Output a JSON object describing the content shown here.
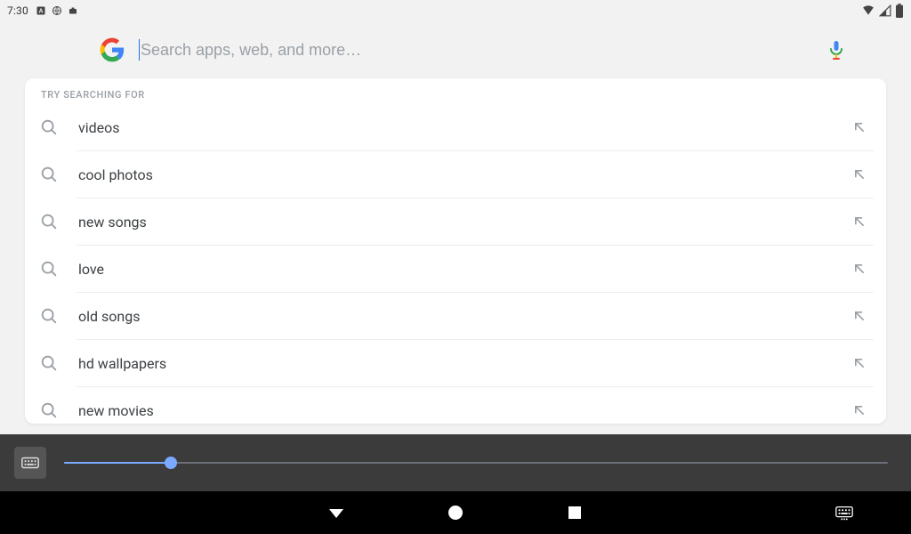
{
  "status_bar": {
    "time": "7:30"
  },
  "search": {
    "placeholder": "Search apps, web, and more…",
    "value": ""
  },
  "suggestions": {
    "header": "TRY SEARCHING FOR",
    "items": [
      {
        "label": "videos"
      },
      {
        "label": "cool photos"
      },
      {
        "label": "new songs"
      },
      {
        "label": "love"
      },
      {
        "label": "old songs"
      },
      {
        "label": "hd wallpapers"
      },
      {
        "label": "new movies"
      }
    ]
  },
  "keyboard": {
    "slider_percent": 13
  }
}
